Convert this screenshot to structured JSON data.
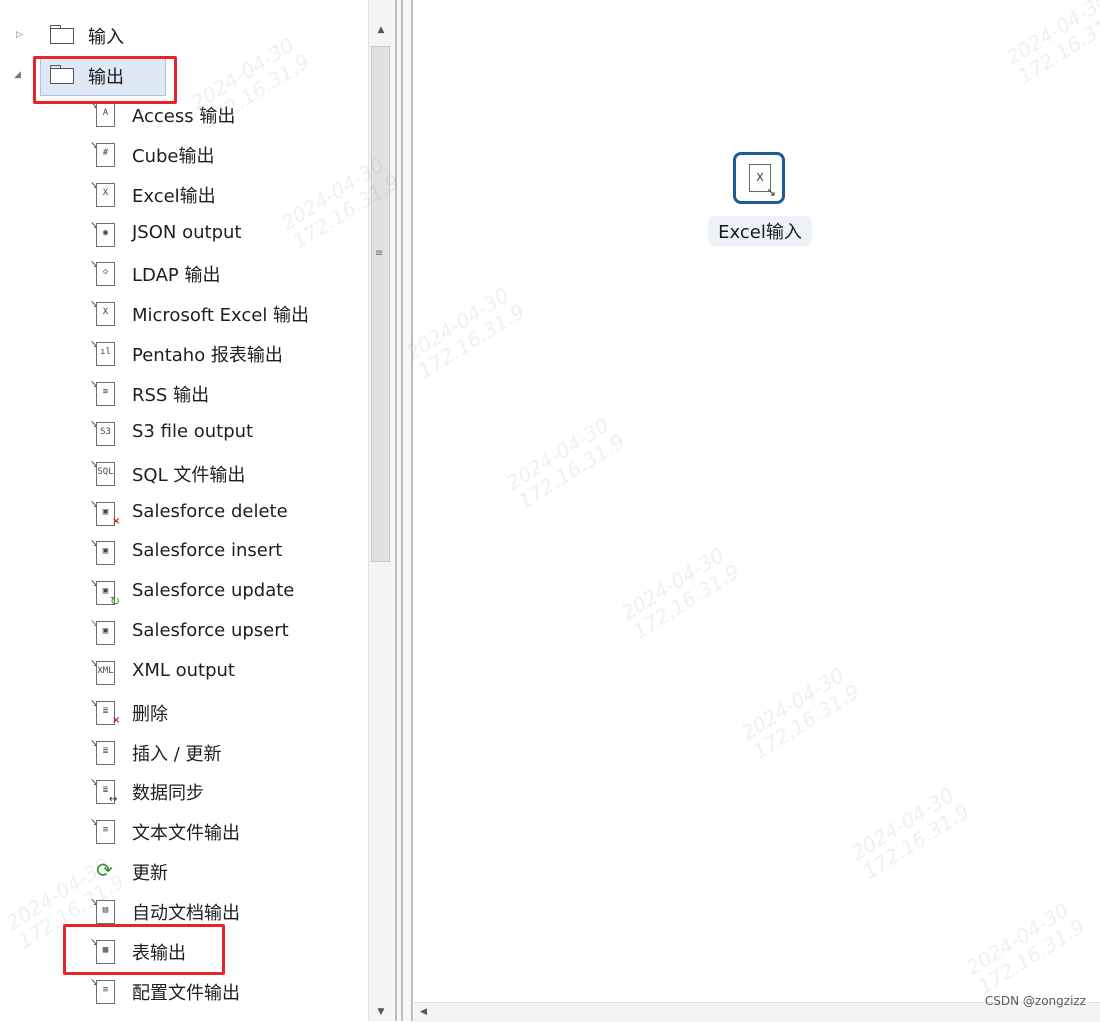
{
  "tree": {
    "folders": [
      {
        "label": "输入",
        "expander": "▷"
      },
      {
        "label": "输出",
        "expander": "◢"
      }
    ],
    "items": [
      {
        "label": "Access 输出",
        "icon": "access-output-icon",
        "glyph": "A"
      },
      {
        "label": "Cube输出",
        "icon": "cube-output-icon",
        "glyph": "#"
      },
      {
        "label": "Excel输出",
        "icon": "excel-output-icon",
        "glyph": "X"
      },
      {
        "label": "JSON output",
        "icon": "json-output-icon",
        "glyph": "◉"
      },
      {
        "label": "LDAP 输出",
        "icon": "ldap-output-icon",
        "glyph": "◇"
      },
      {
        "label": "Microsoft Excel 输出",
        "icon": "microsoft-excel-output-icon",
        "glyph": "X"
      },
      {
        "label": "Pentaho 报表输出",
        "icon": "pentaho-report-output-icon",
        "glyph": "ıl"
      },
      {
        "label": "RSS 输出",
        "icon": "rss-output-icon",
        "glyph": "≋"
      },
      {
        "label": "S3 file output",
        "icon": "s3-file-output-icon",
        "glyph": "S3"
      },
      {
        "label": "SQL 文件输出",
        "icon": "sql-file-output-icon",
        "glyph": "SQL"
      },
      {
        "label": "Salesforce delete",
        "icon": "salesforce-delete-icon",
        "glyph": "▣"
      },
      {
        "label": "Salesforce insert",
        "icon": "salesforce-insert-icon",
        "glyph": "▣"
      },
      {
        "label": "Salesforce update",
        "icon": "salesforce-update-icon",
        "glyph": "▣"
      },
      {
        "label": "Salesforce upsert",
        "icon": "salesforce-upsert-icon",
        "glyph": "▣"
      },
      {
        "label": "XML output",
        "icon": "xml-output-icon",
        "glyph": "XML"
      },
      {
        "label": "删除",
        "icon": "delete-icon",
        "glyph": "≣"
      },
      {
        "label": "插入 / 更新",
        "icon": "insert-update-icon",
        "glyph": "≣"
      },
      {
        "label": "数据同步",
        "icon": "data-sync-icon",
        "glyph": "≣"
      },
      {
        "label": "文本文件输出",
        "icon": "text-file-output-icon",
        "glyph": "≡"
      },
      {
        "label": "更新",
        "icon": "update-icon",
        "glyph": "⟳"
      },
      {
        "label": "自动文档输出",
        "icon": "auto-doc-output-icon",
        "glyph": "▤"
      },
      {
        "label": "表输出",
        "icon": "table-output-icon",
        "glyph": "▦"
      },
      {
        "label": "配置文件输出",
        "icon": "config-file-output-icon",
        "glyph": "≡"
      }
    ]
  },
  "canvas": {
    "node": {
      "label": "Excel输入",
      "icon": "excel-input-icon",
      "glyph": "X"
    }
  },
  "scrollbar": {
    "up": "▲",
    "down": "▼",
    "grip": "≡",
    "left": "◀"
  },
  "watermark": [
    "2024-04-30",
    "172.16.31.9"
  ],
  "credit": "CSDN @zongzizz",
  "colors": {
    "highlight": "#e8232a",
    "node_border": "#1f5a96",
    "selection": "#dfe9f6"
  }
}
